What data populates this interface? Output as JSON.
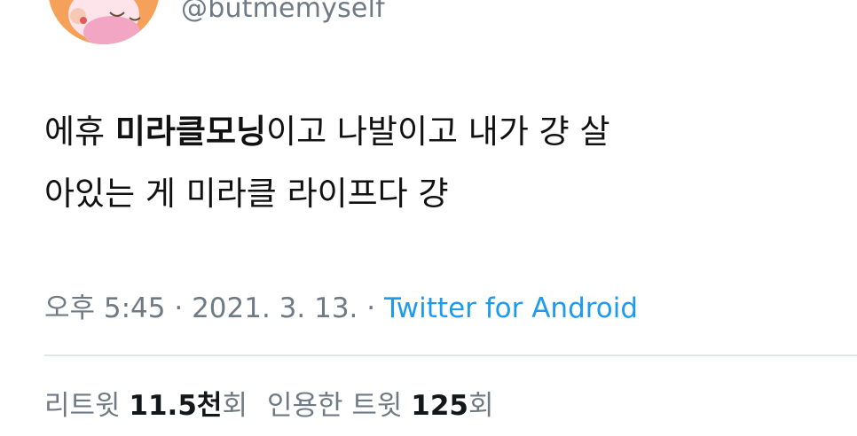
{
  "author": {
    "handle": "@butmemyself"
  },
  "tweet": {
    "text_pre": "에휴 ",
    "text_bold": "미라클모닝",
    "text_post": "이고 나발이고 내가 걍 살\n아있는 게 미라클 라이프다 걍"
  },
  "meta": {
    "time": "오후 5:45",
    "sep1": " · ",
    "date": "2021. 3. 13.",
    "sep2": " · ",
    "source": "Twitter for Android"
  },
  "stats": {
    "retweets_label": "리트윗 ",
    "retweets_value": "11.5천",
    "retweets_unit": "회",
    "quotes_label": "인용한 트윗 ",
    "quotes_value": "125",
    "quotes_unit": "회"
  },
  "colors": {
    "accent": "#1d9bf0",
    "muted": "#6f7a84",
    "avatar_bg": "#f6a15a"
  }
}
